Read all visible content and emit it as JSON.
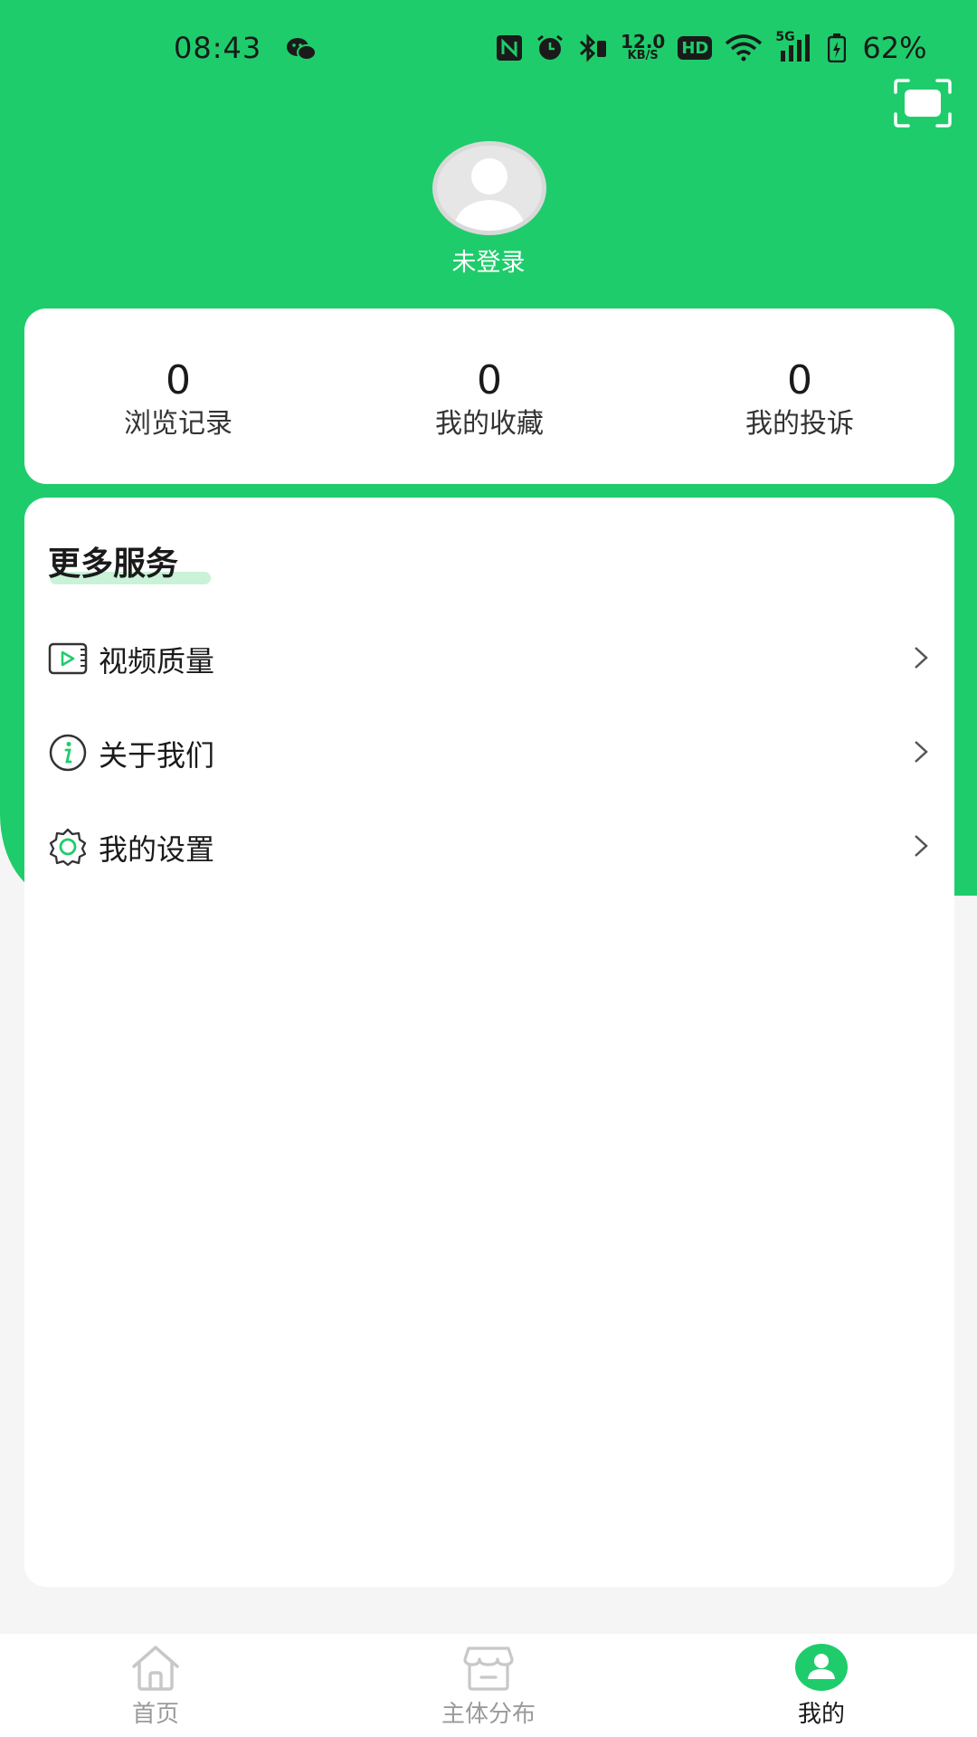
{
  "status_bar": {
    "time": "08:43",
    "network_speed_value": "12.0",
    "network_speed_unit": "KB/S",
    "hd_label": "HD",
    "signal_label": "5G",
    "battery": "62%"
  },
  "header": {
    "login_status": "未登录"
  },
  "stats": [
    {
      "count": "0",
      "label": "浏览记录"
    },
    {
      "count": "0",
      "label": "我的收藏"
    },
    {
      "count": "0",
      "label": "我的投诉"
    }
  ],
  "services": {
    "title": "更多服务",
    "items": [
      {
        "label": "视频质量",
        "icon": "video-icon"
      },
      {
        "label": "关于我们",
        "icon": "info-icon"
      },
      {
        "label": "我的设置",
        "icon": "settings-icon"
      }
    ]
  },
  "bottom_nav": {
    "items": [
      {
        "label": "首页",
        "icon": "home-icon",
        "active": false
      },
      {
        "label": "主体分布",
        "icon": "store-icon",
        "active": false
      },
      {
        "label": "我的",
        "icon": "profile-icon",
        "active": true
      }
    ]
  },
  "colors": {
    "brand_green": "#1fcc6b",
    "inactive_nav": "#9a9a9a",
    "text_dark": "#1a1a1a"
  }
}
